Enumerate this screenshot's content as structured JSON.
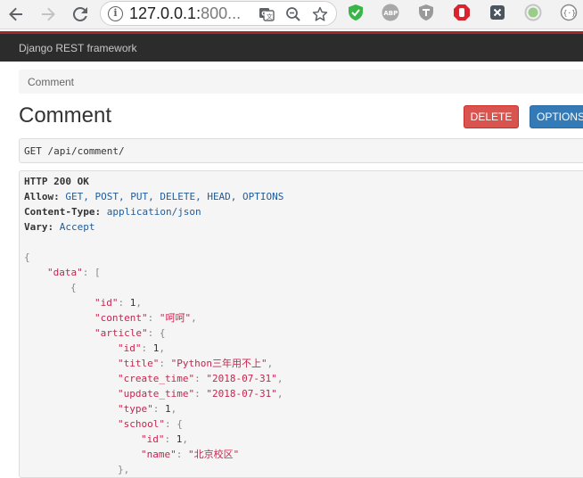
{
  "browser": {
    "url_main": "127.0.0.1:",
    "url_faded": "800..."
  },
  "navbar": {
    "brand": "Django REST framework"
  },
  "breadcrumb": {
    "item": "Comment"
  },
  "page": {
    "title": "Comment"
  },
  "buttons": {
    "delete": "DELETE",
    "options": "OPTIONS"
  },
  "request": {
    "method_line": "GET /api/comment/"
  },
  "response": {
    "status": "HTTP 200 OK",
    "headers": [
      {
        "name": "Allow:",
        "value": "GET, POST, PUT, DELETE, HEAD, OPTIONS"
      },
      {
        "name": "Content-Type:",
        "value": "application/json"
      },
      {
        "name": "Vary:",
        "value": "Accept"
      }
    ],
    "body": {
      "open": "{",
      "data_key": "\"data\"",
      "data_open": "[",
      "obj_open": "{",
      "id_key": "\"id\"",
      "id_val": "1",
      "content_key": "\"content\"",
      "content_val": "\"呵呵\"",
      "article_key": "\"article\"",
      "article_open": "{",
      "article_id_key": "\"id\"",
      "article_id_val": "1",
      "title_key": "\"title\"",
      "title_val": "\"Python三年用不上\"",
      "create_key": "\"create_time\"",
      "create_val": "\"2018-07-31\"",
      "update_key": "\"update_time\"",
      "update_val": "\"2018-07-31\"",
      "type_key": "\"type\"",
      "type_val": "1",
      "school_key": "\"school\"",
      "school_open": "{",
      "school_id_key": "\"id\"",
      "school_id_val": "1",
      "name_key": "\"name\"",
      "name_val": "\"北京校区\"",
      "school_close": "},"
    }
  }
}
